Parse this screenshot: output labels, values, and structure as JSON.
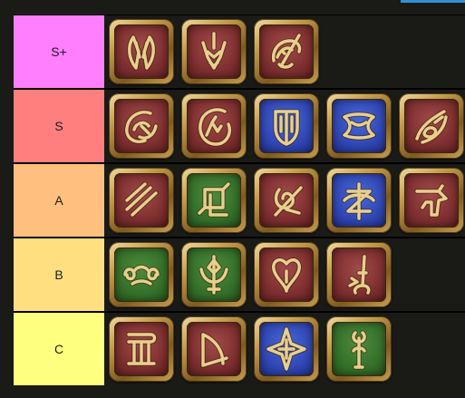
{
  "colors": {
    "tier_s_plus": "#ff7fff",
    "tier_s": "#ff7f7f",
    "tier_a": "#ffbf7f",
    "tier_b": "#ffdf7f",
    "tier_c": "#ffff7f",
    "icon_red": "#7f2f30",
    "icon_blue": "#3047b4",
    "icon_green": "#35702a",
    "icon_gold": "#e9cf8e"
  },
  "tiers": [
    {
      "label": "S+",
      "items": [
        {
          "icon": "dragoon-job-icon",
          "color": "red"
        },
        {
          "icon": "reaper-job-icon",
          "color": "red"
        },
        {
          "icon": "red-mage-job-icon",
          "color": "red"
        }
      ]
    },
    {
      "label": "S",
      "items": [
        {
          "icon": "ninja-job-icon",
          "color": "red"
        },
        {
          "icon": "monk-job-icon",
          "color": "red"
        },
        {
          "icon": "paladin-job-icon",
          "color": "blue"
        },
        {
          "icon": "warrior-job-icon",
          "color": "blue"
        },
        {
          "icon": "black-mage-job-icon",
          "color": "red"
        }
      ]
    },
    {
      "label": "A",
      "items": [
        {
          "icon": "samurai-job-icon",
          "color": "red"
        },
        {
          "icon": "scholar-job-icon",
          "color": "green"
        },
        {
          "icon": "summoner-job-icon",
          "color": "red"
        },
        {
          "icon": "dark-knight-job-icon",
          "color": "blue"
        },
        {
          "icon": "machinist-job-icon",
          "color": "red"
        }
      ]
    },
    {
      "label": "B",
      "items": [
        {
          "icon": "sage-job-icon",
          "color": "green"
        },
        {
          "icon": "astrologian-job-icon",
          "color": "green"
        },
        {
          "icon": "dancer-job-icon",
          "color": "red"
        },
        {
          "icon": "blue-mage-job-icon",
          "color": "red"
        }
      ]
    },
    {
      "label": "C",
      "items": [
        {
          "icon": "bard-job-icon",
          "color": "red"
        },
        {
          "icon": "archer-job-icon",
          "color": "red"
        },
        {
          "icon": "gunbreaker-job-icon",
          "color": "blue"
        },
        {
          "icon": "white-mage-job-icon",
          "color": "green"
        }
      ]
    }
  ]
}
